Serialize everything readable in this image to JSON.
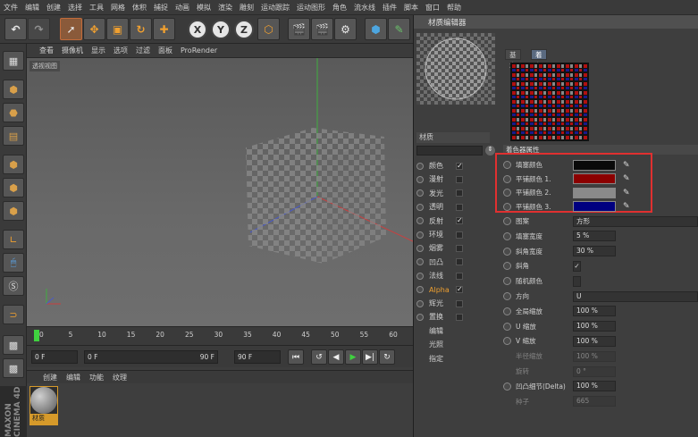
{
  "menu": [
    "文件",
    "编辑",
    "创建",
    "选择",
    "工具",
    "网格",
    "体积",
    "捕捉",
    "动画",
    "模拟",
    "渲染",
    "雕刻",
    "运动跟踪",
    "运动图形",
    "角色",
    "流水线",
    "插件",
    "脚本",
    "窗口",
    "帮助"
  ],
  "toolbar": {
    "x": "X",
    "y": "Y",
    "z": "Z"
  },
  "viewport": {
    "menus": [
      "查看",
      "摄像机",
      "显示",
      "选项",
      "过滤",
      "面板",
      "ProRender"
    ],
    "label": "透视视图"
  },
  "timeline": {
    "ticks": [
      "0",
      "5",
      "10",
      "15",
      "20",
      "25",
      "30",
      "35",
      "40",
      "45",
      "50",
      "55",
      "60"
    ],
    "start": "0 F",
    "cur": "0 F",
    "end": "90 F",
    "end2": "90 F"
  },
  "matmgr": {
    "menus": [
      "创建",
      "编辑",
      "功能",
      "纹理"
    ],
    "material": "材质"
  },
  "brand": "MAXON CINEMA 4D",
  "editor": {
    "title": "材质编辑器",
    "material_name": "材质",
    "tabs": [
      "基本",
      "着色器"
    ],
    "section": "着色器属性",
    "channels": [
      {
        "name": "颜色",
        "checked": "✓"
      },
      {
        "name": "漫射",
        "checked": ""
      },
      {
        "name": "发光",
        "checked": ""
      },
      {
        "name": "透明",
        "checked": ""
      },
      {
        "name": "反射",
        "checked": "✓"
      },
      {
        "name": "环境",
        "checked": ""
      },
      {
        "name": "烟雾",
        "checked": ""
      },
      {
        "name": "凹凸",
        "checked": ""
      },
      {
        "name": "法线",
        "checked": ""
      },
      {
        "name": "Alpha",
        "checked": "✓"
      },
      {
        "name": "辉光",
        "checked": ""
      },
      {
        "name": "置换",
        "checked": ""
      },
      {
        "name": "编辑",
        "checked": ""
      },
      {
        "name": "光照",
        "checked": ""
      },
      {
        "name": "指定",
        "checked": ""
      }
    ],
    "colors": [
      {
        "label": "填塞颜色",
        "hex": "#0a0a0a"
      },
      {
        "label": "平铺颜色 1.",
        "hex": "#8b0000"
      },
      {
        "label": "平铺颜色 2.",
        "hex": "#8a8a8a"
      },
      {
        "label": "平铺颜色 3.",
        "hex": "#000080"
      }
    ],
    "props": [
      {
        "label": "图案",
        "value": "方形"
      },
      {
        "label": "填塞宽度",
        "value": "5 %"
      },
      {
        "label": "斜角宽度",
        "value": "30 %"
      },
      {
        "label": "斜角",
        "value": "✓"
      },
      {
        "label": "随机颜色",
        "value": ""
      },
      {
        "label": "方向",
        "value": "U"
      },
      {
        "label": "全局缩放",
        "value": "100 %"
      },
      {
        "label": "U 缩放",
        "value": "100 %"
      },
      {
        "label": "V 缩放",
        "value": "100 %"
      },
      {
        "label": "半径缩放",
        "value": "100 %"
      },
      {
        "label": "旋转",
        "value": "0 °"
      },
      {
        "label": "凹凸细节(Delta)",
        "value": "100 %"
      },
      {
        "label": "种子",
        "value": "665"
      }
    ]
  }
}
